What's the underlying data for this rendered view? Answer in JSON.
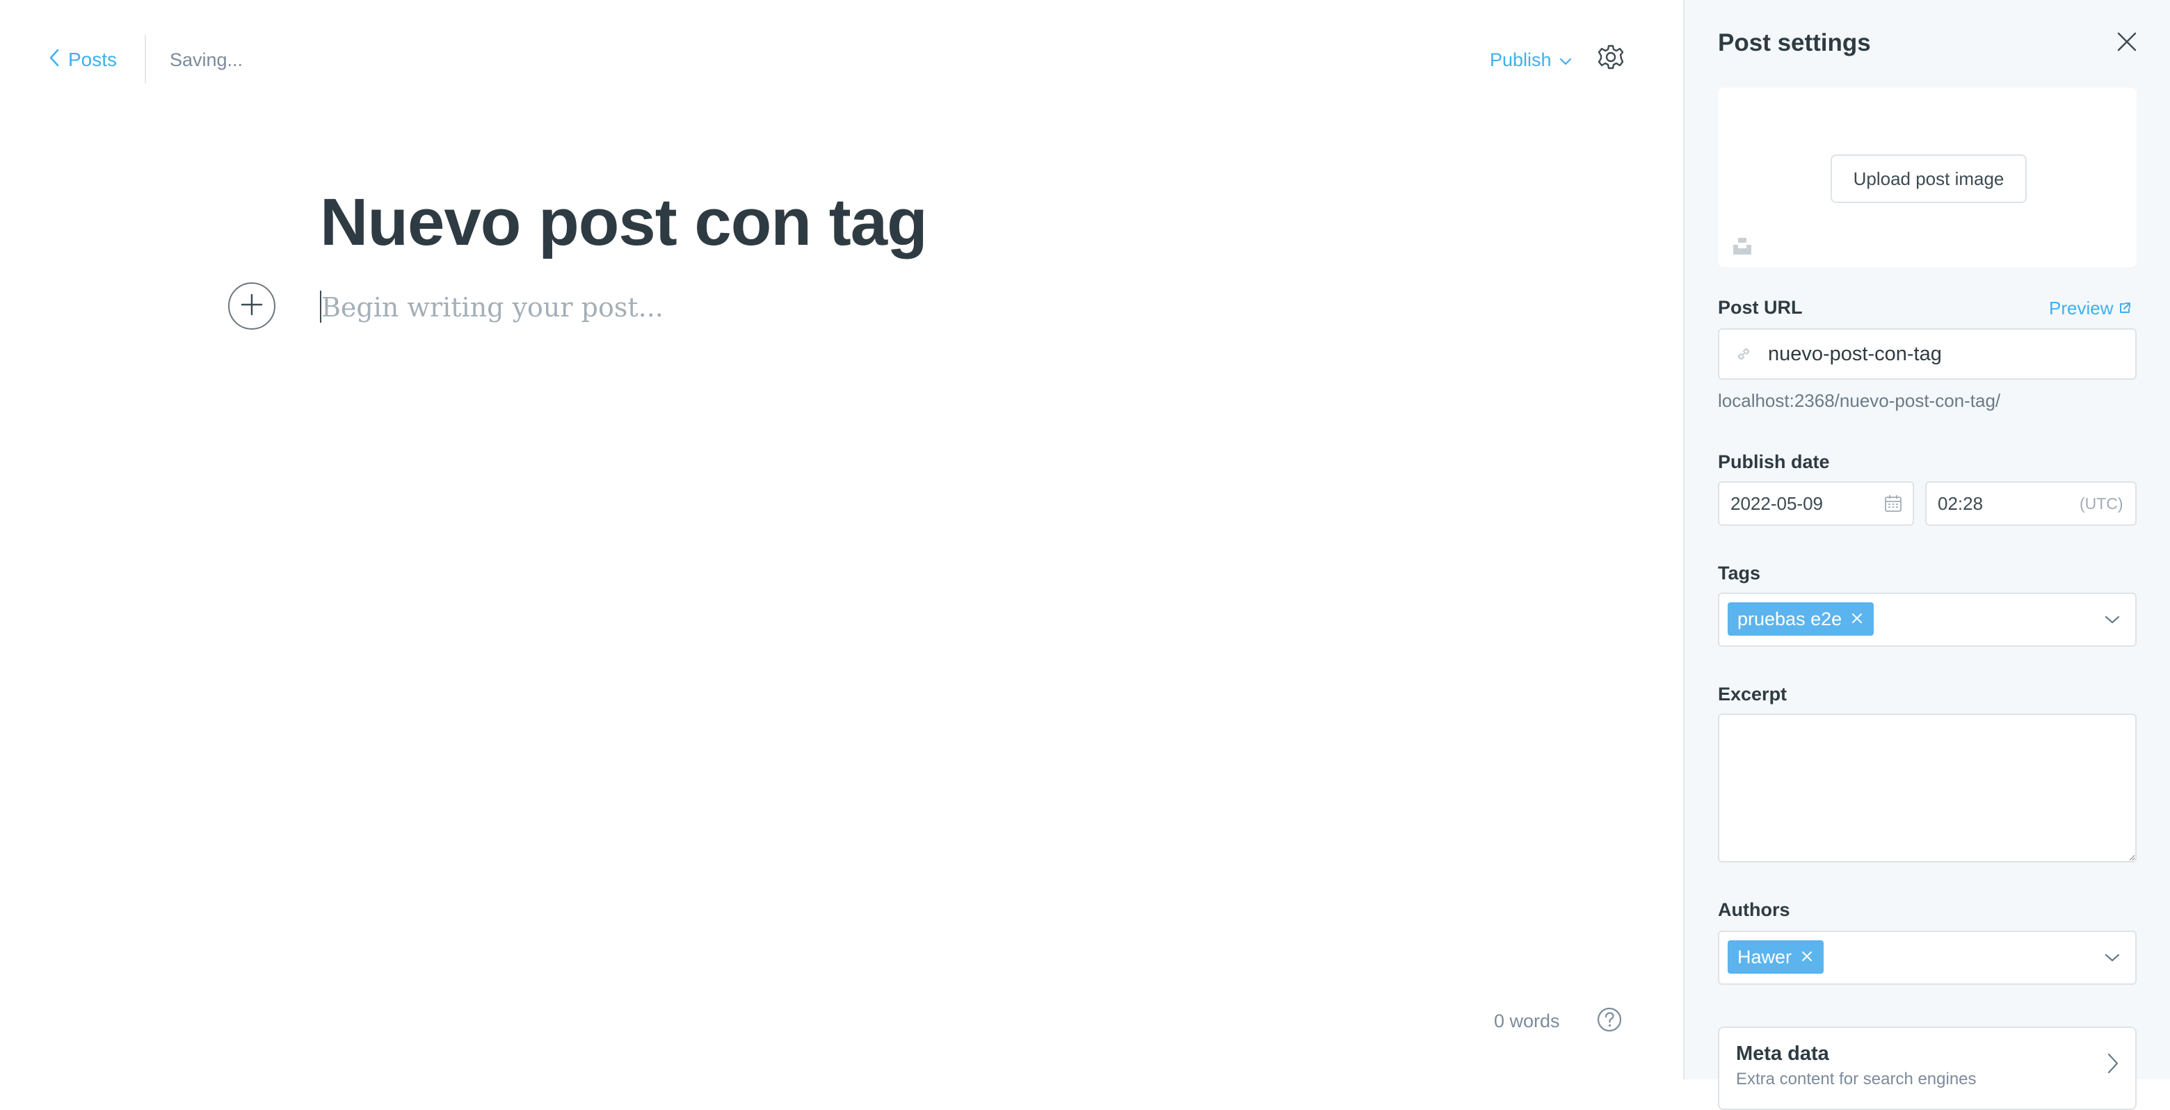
{
  "toolbar": {
    "back_label": "Posts",
    "status": "Saving...",
    "publish_label": "Publish"
  },
  "editor": {
    "title": "Nuevo post con tag",
    "body_placeholder": "Begin writing your post...",
    "word_count": "0 words"
  },
  "settings": {
    "title": "Post settings",
    "upload_label": "Upload post image",
    "post_url": {
      "label": "Post URL",
      "preview_label": "Preview",
      "value": "nuevo-post-con-tag",
      "full_url": "localhost:2368/nuevo-post-con-tag/"
    },
    "publish_date": {
      "label": "Publish date",
      "date": "2022-05-09",
      "time": "02:28",
      "timezone": "(UTC)"
    },
    "tags": {
      "label": "Tags",
      "items": [
        "pruebas e2e"
      ]
    },
    "excerpt": {
      "label": "Excerpt",
      "value": ""
    },
    "authors": {
      "label": "Authors",
      "items": [
        "Hawer"
      ]
    },
    "meta": {
      "title": "Meta data",
      "subtitle": "Extra content for search engines"
    }
  },
  "colors": {
    "accent": "#3eb0ef",
    "chip": "#5bb4ee",
    "panel_bg": "#f4f8fb",
    "title_text": "#2f3b42"
  }
}
